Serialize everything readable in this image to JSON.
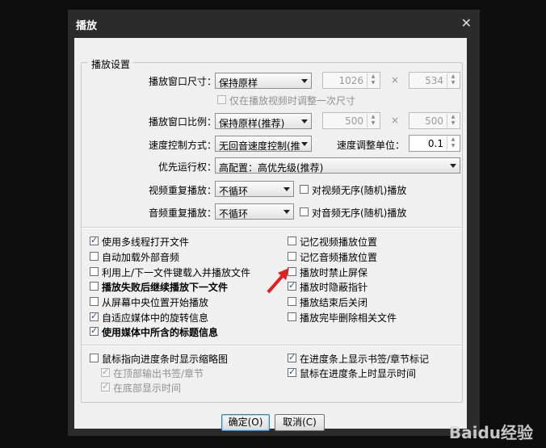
{
  "dialog": {
    "title": "播放",
    "close_glyph": "✕"
  },
  "group_label": "播放设置",
  "window_size": {
    "label": "播放窗口尺寸：",
    "select": "保持原样",
    "width": "1026",
    "height": "534",
    "times": "×",
    "adjust_once": "仅在播放视频时调整一次尺寸"
  },
  "aspect_ratio": {
    "label": "播放窗口比例：",
    "select": "保持原样(推荐)",
    "width": "500",
    "height": "500",
    "times": "×"
  },
  "speed": {
    "label": "速度控制方式：",
    "select": "无回音速度控制(推",
    "unit_label": "速度调整单位：",
    "unit_value": "0.1"
  },
  "priority": {
    "label": "优先运行权：",
    "select": "高配置：高优先级(推荐)"
  },
  "video_repeat": {
    "label": "视频重复播放：",
    "select": "不循环",
    "random_label": "对视频无序(随机)播放"
  },
  "audio_repeat": {
    "label": "音频重复播放：",
    "select": "不循环",
    "random_label": "对音频无序(随机)播放"
  },
  "options_left": [
    {
      "label": "使用多线程打开文件",
      "checked": true,
      "bold": false
    },
    {
      "label": "自动加载外部音频",
      "checked": false,
      "bold": false
    },
    {
      "label": "利用上/下一文件键载入并播放文件",
      "checked": false,
      "bold": false
    },
    {
      "label": "播放失败后继续播放下一文件",
      "checked": false,
      "bold": true
    },
    {
      "label": "从屏幕中央位置开始播放",
      "checked": false,
      "bold": false
    },
    {
      "label": "自适应媒体中的旋转信息",
      "checked": true,
      "bold": false
    },
    {
      "label": "使用媒体中所含的标题信息",
      "checked": true,
      "bold": true
    }
  ],
  "options_right": [
    {
      "label": "记忆视频播放位置",
      "checked": false
    },
    {
      "label": "记忆音频播放位置",
      "checked": false
    },
    {
      "label": "播放时禁止屏保",
      "checked": false
    },
    {
      "label": "播放时隐蔽指针",
      "checked": true
    },
    {
      "label": "播放结束后关闭",
      "checked": false
    },
    {
      "label": "播放完毕删除相关文件",
      "checked": false
    }
  ],
  "thumbnail": {
    "label": "鼠标指向进度条时显示缩略图",
    "sub1": "在顶部输出书签/章节",
    "sub2": "在底部显示时间"
  },
  "progress_right": [
    {
      "label": "在进度条上显示书签/章节标记",
      "checked": true
    },
    {
      "label": "鼠标在进度条上时显示时间",
      "checked": true
    }
  ],
  "buttons": {
    "ok": "确定(O)",
    "cancel": "取消(C)"
  },
  "watermark": "Baidu经验",
  "accent_color": "#1f4f9e",
  "arrow_color": "#e02020"
}
